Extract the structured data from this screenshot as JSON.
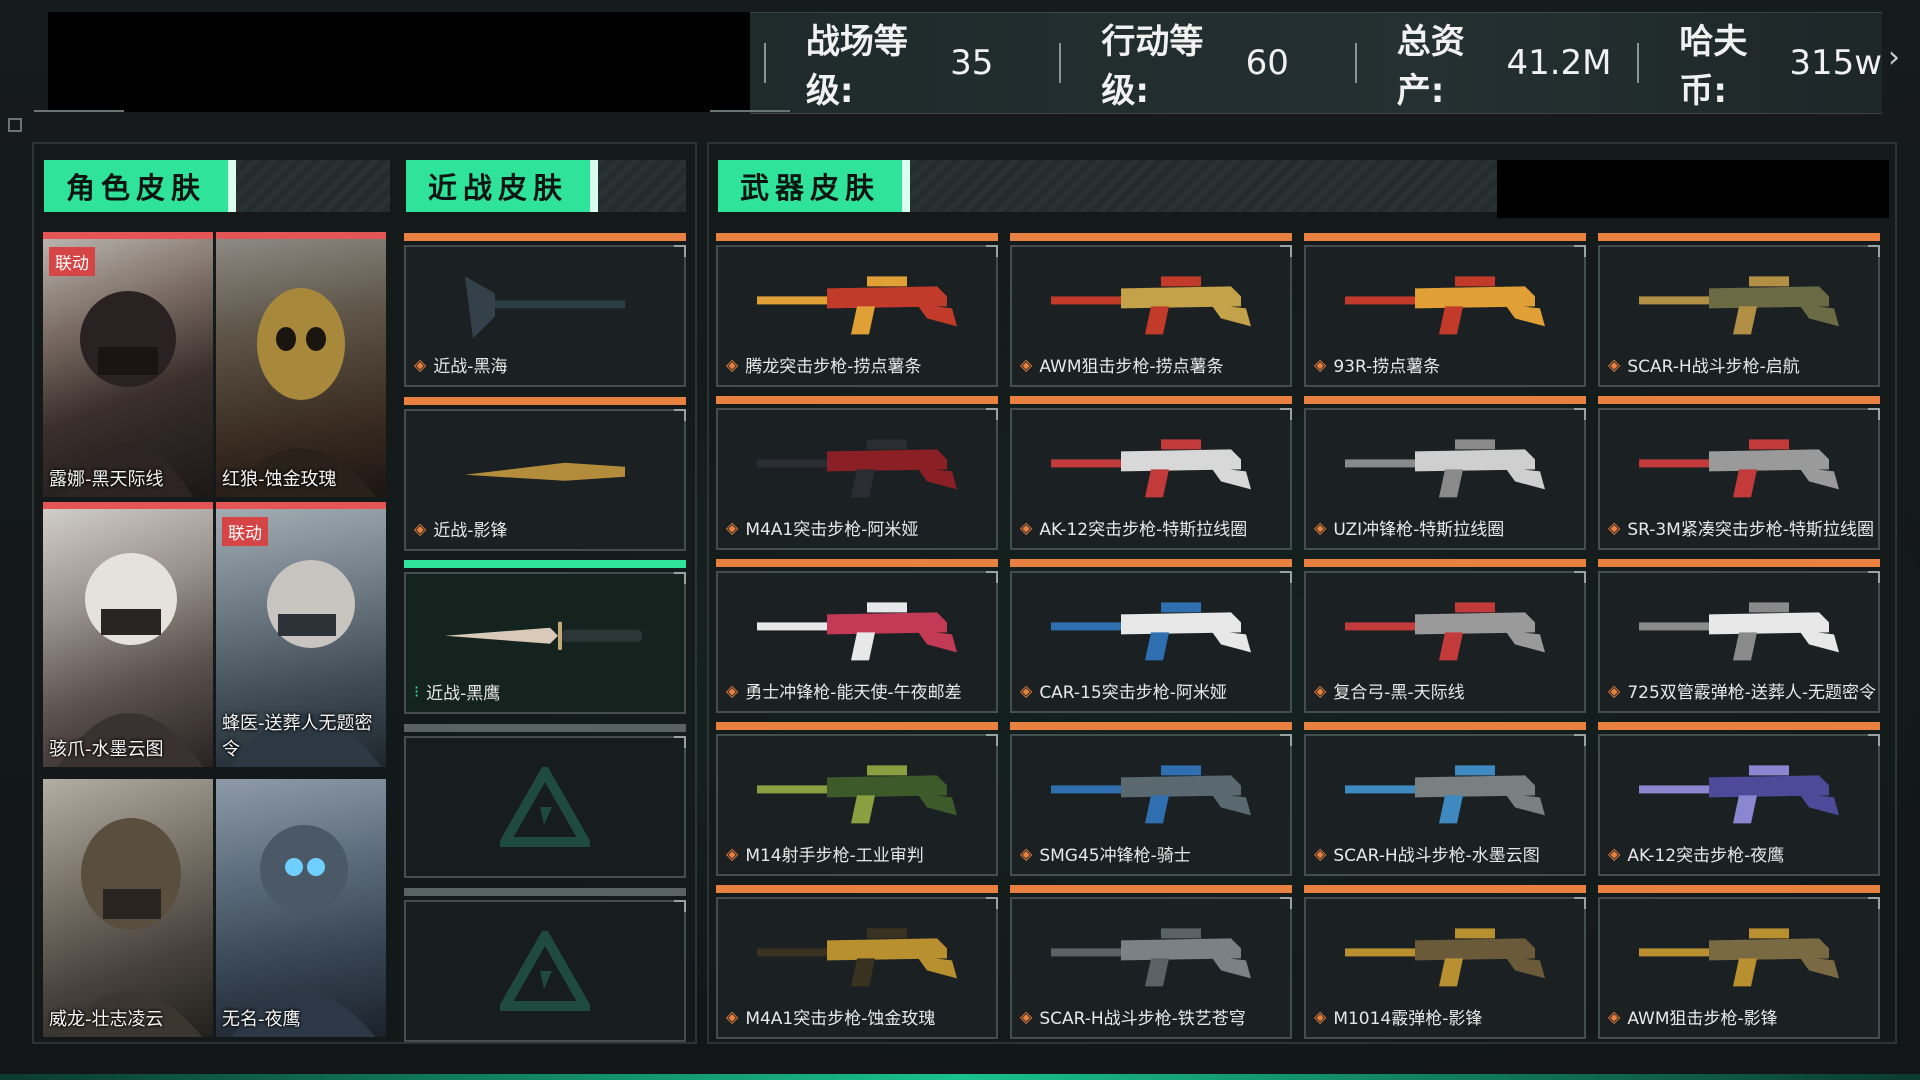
{
  "stats": [
    {
      "label": "战场等级:",
      "value": "35"
    },
    {
      "label": "行动等级:",
      "value": "60"
    },
    {
      "label": "总资产:",
      "value": "41.2M"
    },
    {
      "label": "哈夫币:",
      "value": "315w"
    }
  ],
  "sections": {
    "character": "角色皮肤",
    "melee": "近战皮肤",
    "weapon": "武器皮肤"
  },
  "characters": [
    {
      "name": "露娜-黑天际线",
      "badge": "联动"
    },
    {
      "name": "红狼-蚀金玫瑰",
      "badge": ""
    },
    {
      "name": "骇爪-水墨云图",
      "badge": ""
    },
    {
      "name": "蜂医-送葬人无题密令",
      "badge": "联动"
    },
    {
      "name": "威龙-壮志凌云",
      "badge": ""
    },
    {
      "name": "无名-夜鹰",
      "badge": ""
    }
  ],
  "melee": [
    {
      "name": "近战-黑海",
      "rarity": "orange"
    },
    {
      "name": "近战-影锋",
      "rarity": "orange"
    },
    {
      "name": "近战-黑鹰",
      "rarity": "green"
    },
    {
      "name": "",
      "rarity": "empty"
    },
    {
      "name": "",
      "rarity": "empty"
    }
  ],
  "weapons": [
    {
      "name": "腾龙突击步枪-捞点薯条"
    },
    {
      "name": "AWM狙击步枪-捞点薯条"
    },
    {
      "name": "93R-捞点薯条"
    },
    {
      "name": "SCAR-H战斗步枪-启航"
    },
    {
      "name": "M4A1突击步枪-阿米娅"
    },
    {
      "name": "AK-12突击步枪-特斯拉线圈"
    },
    {
      "name": "UZI冲锋枪-特斯拉线圈"
    },
    {
      "name": "SR-3M紧凑突击步枪-特斯拉线圈"
    },
    {
      "name": "勇士冲锋枪-能天使-午夜邮差"
    },
    {
      "name": "CAR-15突击步枪-阿米娅"
    },
    {
      "name": "复合弓-黑-天际线"
    },
    {
      "name": "725双管霰弹枪-送葬人-无题密令"
    },
    {
      "name": "M14射手步枪-工业审判"
    },
    {
      "name": "SMG45冲锋枪-骑士"
    },
    {
      "name": "SCAR-H战斗步枪-水墨云图"
    },
    {
      "name": "AK-12突击步枪-夜鹰"
    },
    {
      "name": "M4A1突击步枪-蚀金玫瑰"
    },
    {
      "name": "SCAR-H战斗步枪-铁艺苍穹"
    },
    {
      "name": "M1014霰弹枪-影锋"
    },
    {
      "name": "AWM狙击步枪-影锋"
    }
  ],
  "colors": {
    "accent": "#2fe49a",
    "rarity_orange": "#e8803f",
    "rarity_red": "#e45656"
  }
}
